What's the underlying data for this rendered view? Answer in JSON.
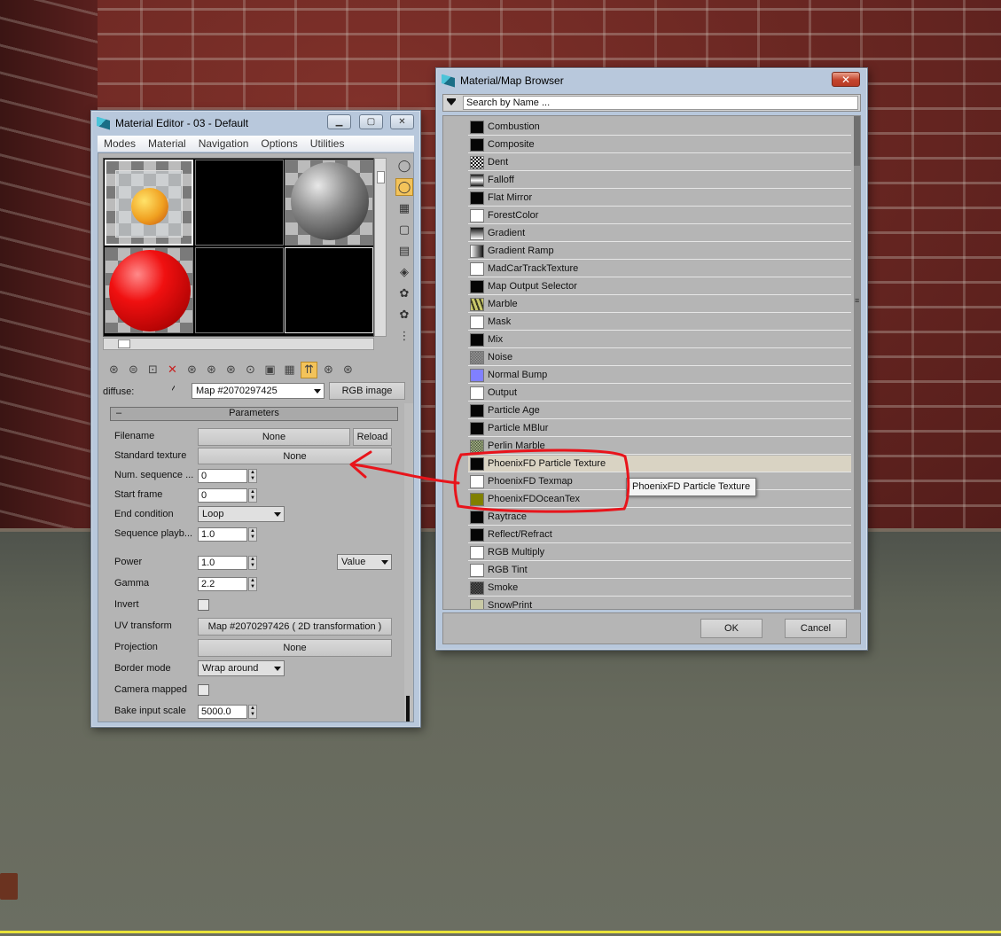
{
  "material_editor": {
    "title": "Material Editor - 03 - Default",
    "menu": [
      "Modes",
      "Material",
      "Navigation",
      "Options",
      "Utilities"
    ],
    "diffuse_label": "diffuse:",
    "map_name": "Map #2070297425",
    "map_type": "RGB image",
    "rollout_title": "Parameters",
    "rollout_collapse": "–",
    "params": {
      "filename_label": "Filename",
      "filename_value": "None",
      "reload_label": "Reload",
      "standard_texture_label": "Standard texture",
      "standard_texture_value": "None",
      "num_sequence_label": "Num. sequence ...",
      "num_sequence_value": "0",
      "start_frame_label": "Start frame",
      "start_frame_value": "0",
      "end_condition_label": "End condition",
      "end_condition_value": "Loop",
      "sequence_playback_label": "Sequence playb...",
      "sequence_playback_value": "1.0",
      "power_label": "Power",
      "power_value": "1.0",
      "power_mode": "Value",
      "gamma_label": "Gamma",
      "gamma_value": "2.2",
      "invert_label": "Invert",
      "uv_transform_label": "UV transform",
      "uv_transform_value": "Map #2070297426  ( 2D transformation )",
      "projection_label": "Projection",
      "projection_value": "None",
      "border_mode_label": "Border mode",
      "border_mode_value": "Wrap around",
      "camera_mapped_label": "Camera mapped",
      "bake_input_scale_label": "Bake input scale",
      "bake_input_scale_value": "5000.0"
    }
  },
  "browser": {
    "title": "Material/Map Browser",
    "search_placeholder": "Search by Name ...",
    "items": [
      {
        "name": "Combustion",
        "swatch": "#050505"
      },
      {
        "name": "Composite",
        "swatch": "#050505"
      },
      {
        "name": "Dent",
        "swatch": "pattern-dent"
      },
      {
        "name": "Falloff",
        "swatch": "gradient-falloff"
      },
      {
        "name": "Flat Mirror",
        "swatch": "#050505"
      },
      {
        "name": "ForestColor",
        "swatch": "#ffffff"
      },
      {
        "name": "Gradient",
        "swatch": "gradient-vertical"
      },
      {
        "name": "Gradient Ramp",
        "swatch": "gradient-horizontal"
      },
      {
        "name": "MadCarTrackTexture",
        "swatch": "#ffffff"
      },
      {
        "name": "Map Output Selector",
        "swatch": "#050505"
      },
      {
        "name": "Marble",
        "swatch": "pattern-marble"
      },
      {
        "name": "Mask",
        "swatch": "#ffffff"
      },
      {
        "name": "Mix",
        "swatch": "#050505"
      },
      {
        "name": "Noise",
        "swatch": "pattern-noise"
      },
      {
        "name": "Normal Bump",
        "swatch": "#8080ff"
      },
      {
        "name": "Output",
        "swatch": "#ffffff"
      },
      {
        "name": "Particle Age",
        "swatch": "#050505"
      },
      {
        "name": "Particle MBlur",
        "swatch": "#050505"
      },
      {
        "name": "Perlin Marble",
        "swatch": "pattern-perlin"
      },
      {
        "name": "PhoenixFD Particle Texture",
        "swatch": "#050505"
      },
      {
        "name": "PhoenixFD Texmap",
        "swatch": "pattern-phoenix"
      },
      {
        "name": "PhoenixFDOceanTex",
        "swatch": "#808000"
      },
      {
        "name": "Raytrace",
        "swatch": "#050505"
      },
      {
        "name": "Reflect/Refract",
        "swatch": "#050505"
      },
      {
        "name": "RGB Multiply",
        "swatch": "#ffffff"
      },
      {
        "name": "RGB Tint",
        "swatch": "#ffffff"
      },
      {
        "name": "Smoke",
        "swatch": "pattern-smoke"
      },
      {
        "name": "SnowPrint",
        "swatch": "#c9c9a5"
      }
    ],
    "highlighted_item": "PhoenixFD Particle Texture",
    "ok_label": "OK",
    "cancel_label": "Cancel",
    "tooltip": "PhoenixFD Particle Texture"
  },
  "colors": {
    "annotation": "#e8141b",
    "active_tool": "#f3c35a"
  }
}
